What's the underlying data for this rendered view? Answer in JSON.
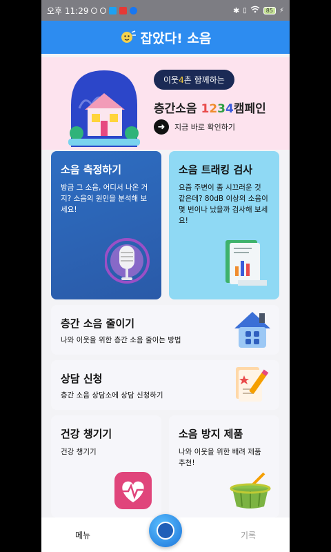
{
  "status_bar": {
    "time": "오후 11:29",
    "battery": "85"
  },
  "header": {
    "title": "잡았다! 소음"
  },
  "banner": {
    "pill_prefix": "이웃",
    "pill_number": "4",
    "pill_suffix": "촌 함께하는",
    "campaign_prefix": "층간소음 ",
    "d1": "1",
    "d2": "2",
    "d3": "3",
    "d4": "4",
    "campaign_suffix": "캠페인",
    "link_label": "지금 바로 확인하기"
  },
  "cards": {
    "measure": {
      "title": "소음 측정하기",
      "desc": "방금 그 소음, 어디서 나온 거지? 소음의 원인을 분석해 보세요!"
    },
    "track": {
      "title": "소음 트래킹 검사",
      "desc": "요즘 주변이 좀 시끄러운 것 같은데? 80dB 이상의 소음이 몇 번이나 났을까 검사해 보세요!"
    },
    "reduce": {
      "title": "층간 소음 줄이기",
      "desc": "나와 이웃을 위한 층간 소음 줄이는 방법"
    },
    "consult": {
      "title": "상담 신청",
      "desc": "층간 소음 상담소에 상담 신청하기"
    },
    "health": {
      "title": "건강 챙기기",
      "desc": "건강 챙기기"
    },
    "product": {
      "title": "소음 방지 제품",
      "desc": "나와 이웃을 위한 배려 제품 추천!"
    }
  },
  "bottom_nav": {
    "menu_label": "메뉴",
    "record_label": "기록"
  },
  "colors": {
    "header": "#2d8cf0",
    "banner_bg": "#fde3ee",
    "measure_card": "#2e6ec2",
    "track_card": "#8fd9f4"
  }
}
